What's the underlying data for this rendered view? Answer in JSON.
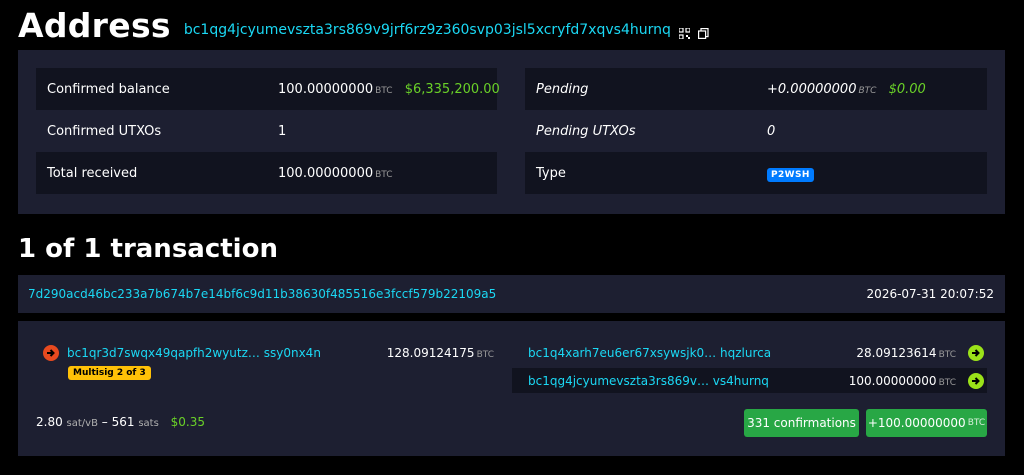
{
  "header": {
    "title": "Address",
    "address": "bc1qg4jcyumevszta3rs869v9jrf6rz9z360svp03jsl5xcryfd7xqvs4hurnq"
  },
  "summary": {
    "left": [
      {
        "label": "Confirmed balance",
        "value": "100.00000000",
        "unit": "BTC",
        "fiat": "$6,335,200.00"
      },
      {
        "label": "Confirmed UTXOs",
        "value": "1"
      },
      {
        "label": "Total received",
        "value": "100.00000000",
        "unit": "BTC"
      }
    ],
    "right": [
      {
        "label": "Pending",
        "value": "+0.00000000",
        "unit": "BTC",
        "fiat": "$0.00"
      },
      {
        "label": "Pending UTXOs",
        "value": "0"
      },
      {
        "label": "Type",
        "badge": "P2WSH"
      }
    ]
  },
  "transactions": {
    "title": "1 of 1 transaction",
    "txid": "7d290acd46bc233a7b674b7e14bf6c9d11b38630f485516e3fccf579b22109a5",
    "timestamp": "2026-07-31 20:07:52",
    "input": {
      "address": "bc1qr3d7swqx49qapfh2wyutz… ssy0nx4n",
      "amount": "128.09124175",
      "unit": "BTC",
      "badge": "Multisig 2 of 3"
    },
    "outputs": [
      {
        "address": "bc1q4xarh7eu6er67xsywsjk0… hqzlurca",
        "amount": "28.09123614",
        "unit": "BTC"
      },
      {
        "address": "bc1qg4jcyumevszta3rs869v… vs4hurnq",
        "amount": "100.00000000",
        "unit": "BTC"
      }
    ],
    "fee": {
      "rate": "2.80",
      "rate_unit": "sat/vB",
      "sep": "–",
      "sats": "561",
      "sats_unit": "sats",
      "fiat": "$0.35"
    },
    "confirmations": "331 confirmations",
    "net": {
      "amount": "+100.00000000",
      "unit": "BTC"
    }
  },
  "colors": {
    "accent_link": "#1bd8f4",
    "fiat_green": "#6ad128",
    "panel_bg": "#1d1f31",
    "row_dark": "#11131f",
    "badge_blue": "#007bff",
    "badge_yellow": "#ffc107",
    "button_green": "#28a745",
    "input_red": "#e84a1f",
    "output_green": "#9be219"
  },
  "icons": [
    "qr-code-icon",
    "copy-icon",
    "input-arrow-icon",
    "output-arrow-icon"
  ]
}
